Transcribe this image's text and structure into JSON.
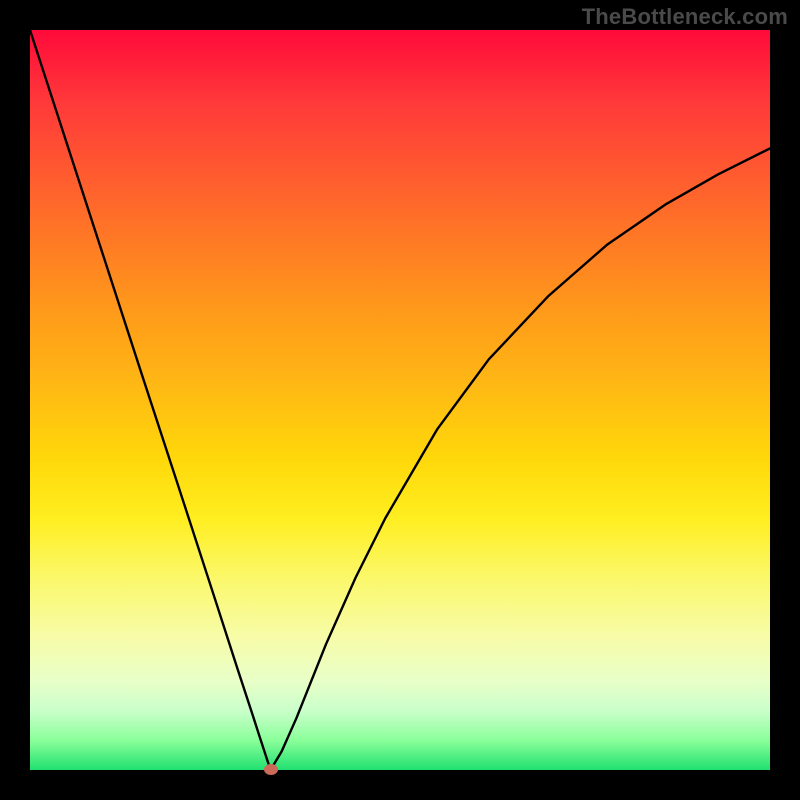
{
  "watermark": "TheBottleneck.com",
  "chart_data": {
    "type": "line",
    "title": "",
    "xlabel": "",
    "ylabel": "",
    "xlim": [
      0,
      1
    ],
    "ylim": [
      0,
      100
    ],
    "grid": false,
    "legend": false,
    "background_gradient": {
      "top_color": "#ff0a3a",
      "bottom_color": "#20e070",
      "description": "vertical red-to-green gradient (high bottleneck at top, optimal at bottom)"
    },
    "series": [
      {
        "name": "bottleneck-curve",
        "color": "#000000",
        "x": [
          0.0,
          0.05,
          0.1,
          0.15,
          0.2,
          0.25,
          0.28,
          0.3,
          0.31,
          0.325,
          0.34,
          0.36,
          0.38,
          0.4,
          0.44,
          0.48,
          0.55,
          0.62,
          0.7,
          0.78,
          0.86,
          0.93,
          1.0
        ],
        "y": [
          100.0,
          84.6,
          69.2,
          53.8,
          38.5,
          23.1,
          13.8,
          7.7,
          4.6,
          0.0,
          2.5,
          7.0,
          12.0,
          17.0,
          26.0,
          34.0,
          46.0,
          55.5,
          64.0,
          71.0,
          76.5,
          80.5,
          84.0
        ]
      }
    ],
    "marker": {
      "name": "optimal-point",
      "x": 0.325,
      "y": 0,
      "color": "#cc6a5a"
    }
  }
}
